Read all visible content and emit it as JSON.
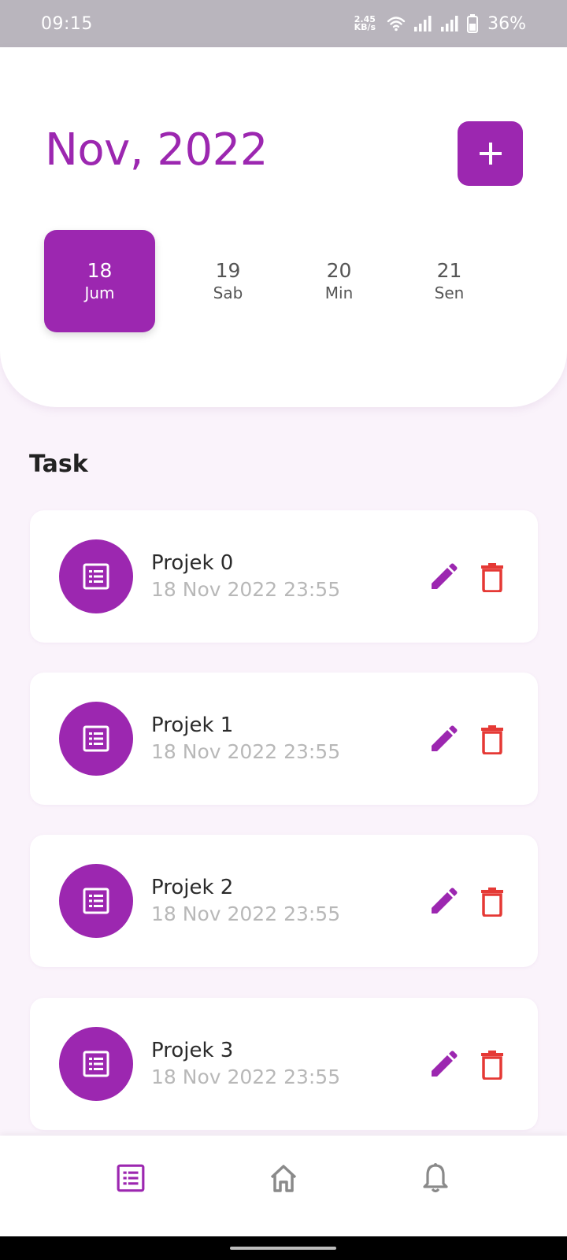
{
  "status_bar": {
    "time": "09:15",
    "net_speed_value": "2.45",
    "net_speed_unit": "KB/s",
    "battery_percent": "36%"
  },
  "header": {
    "month_year": "Nov, 2022",
    "add_icon": "plus-icon",
    "dates": [
      {
        "day_number": "18",
        "day_name": "Jum",
        "selected": true
      },
      {
        "day_number": "19",
        "day_name": "Sab",
        "selected": false
      },
      {
        "day_number": "20",
        "day_name": "Min",
        "selected": false
      },
      {
        "day_number": "21",
        "day_name": "Sen",
        "selected": false
      }
    ]
  },
  "tasks_section": {
    "heading": "Task",
    "tasks": [
      {
        "title": "Projek 0",
        "datetime": "18 Nov 2022 23:55"
      },
      {
        "title": "Projek 1",
        "datetime": "18 Nov 2022 23:55"
      },
      {
        "title": "Projek 2",
        "datetime": "18 Nov 2022 23:55"
      },
      {
        "title": "Projek 3",
        "datetime": "18 Nov 2022 23:55"
      }
    ]
  },
  "bottom_nav": {
    "items": [
      {
        "icon": "task-list-icon",
        "active": true
      },
      {
        "icon": "home-icon",
        "active": false
      },
      {
        "icon": "bell-icon",
        "active": false
      }
    ]
  },
  "colors": {
    "accent": "#9c27b0",
    "delete": "#e53935",
    "background": "#faf3fb",
    "muted_text": "#b8b8b8"
  }
}
